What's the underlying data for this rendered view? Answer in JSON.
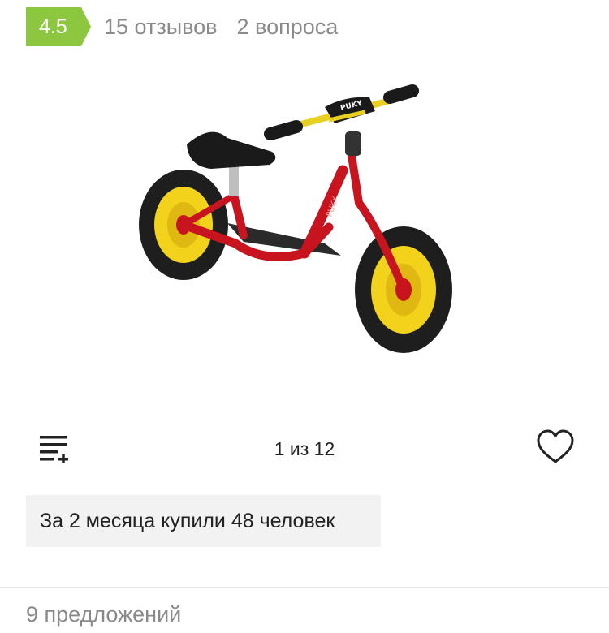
{
  "rating": {
    "score": "4.5",
    "reviews_label": "15 отзывов",
    "questions_label": "2 вопроса"
  },
  "product_image": {
    "brand_text": "PUKY"
  },
  "gallery": {
    "counter": "1 из 12"
  },
  "purchase_note": "За 2 месяца купили 48 человек",
  "offers_label": "9 предложений",
  "colors": {
    "rating_badge": "#8dc63f",
    "muted_text": "#8a8a8a",
    "frame_red": "#c8141e",
    "wheel_yellow": "#f2d21a",
    "note_background": "#f2f2f2"
  }
}
